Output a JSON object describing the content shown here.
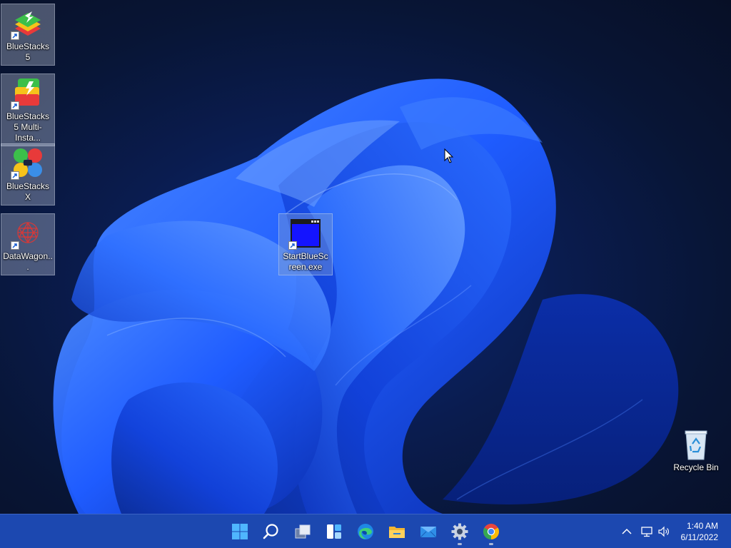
{
  "desktop_icons": [
    {
      "label": "BlueStacks 5",
      "icon": "bluestacks-5-icon"
    },
    {
      "label": "BlueStacks 5 Multi-Insta...",
      "icon": "bluestacks-multi-instance-icon"
    },
    {
      "label": "BlueStacks X",
      "icon": "bluestacks-x-icon"
    },
    {
      "label": "DataWagon...",
      "icon": "datawagon-icon"
    },
    {
      "label": "StartBlueScreen.exe",
      "icon": "exe-window-icon",
      "selected": true
    },
    {
      "label": "Recycle Bin",
      "icon": "recycle-bin-icon"
    }
  ],
  "taskbar": {
    "apps": [
      {
        "name": "Start",
        "icon": "windows-start-icon"
      },
      {
        "name": "Search",
        "icon": "search-icon"
      },
      {
        "name": "Task View",
        "icon": "task-view-icon"
      },
      {
        "name": "Widgets",
        "icon": "widgets-icon"
      },
      {
        "name": "Microsoft Edge",
        "icon": "edge-icon"
      },
      {
        "name": "File Explorer",
        "icon": "file-explorer-icon"
      },
      {
        "name": "Mail",
        "icon": "mail-icon"
      },
      {
        "name": "Settings",
        "icon": "settings-gear-icon",
        "running": true
      },
      {
        "name": "Google Chrome",
        "icon": "chrome-icon",
        "running": true
      }
    ],
    "tray": {
      "icons": [
        "chevron-up-icon",
        "network-icon",
        "volume-icon"
      ]
    },
    "clock": {
      "time": "1:40 AM",
      "date": "6/11/2022"
    }
  },
  "colors": {
    "taskbar": "#1c48b0",
    "wallpaper_bloom": "#1f5cff",
    "desktop_background": "#081535"
  }
}
